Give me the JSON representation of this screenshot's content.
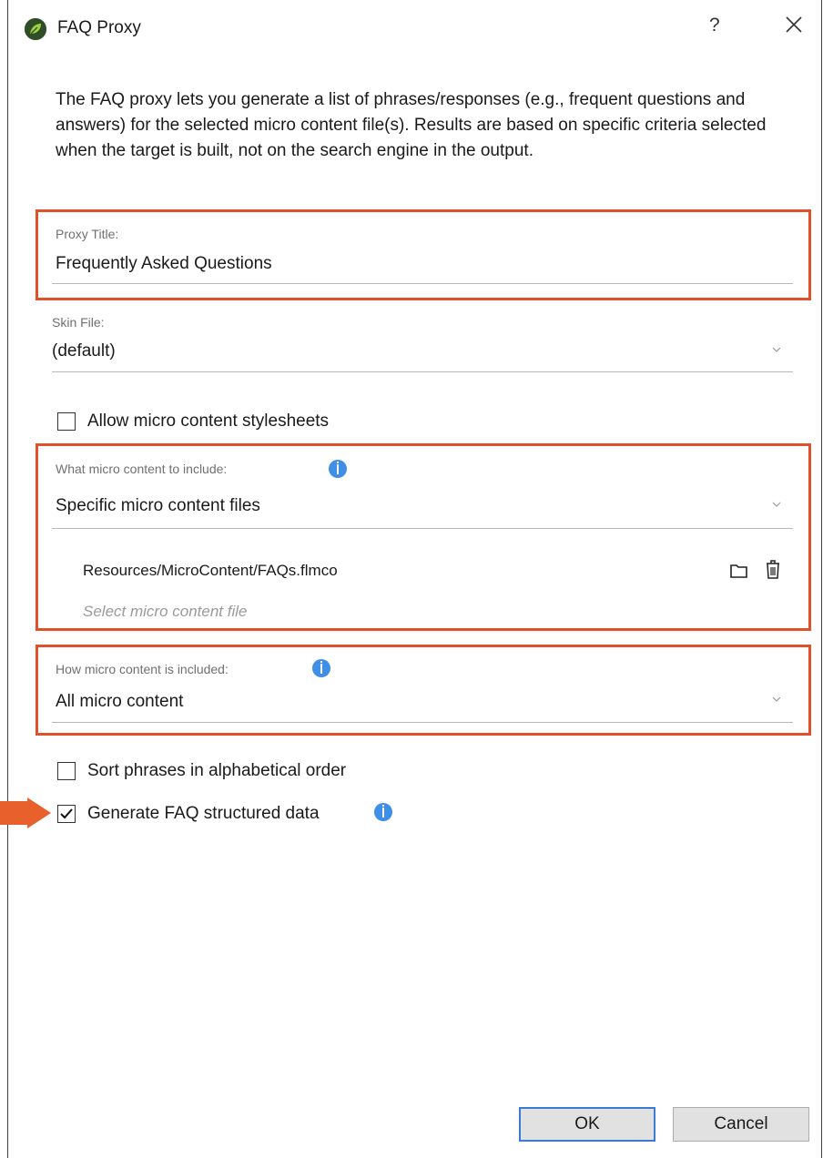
{
  "window": {
    "title": "FAQ Proxy",
    "help_label": "?",
    "close_icon": "close-icon"
  },
  "description": "The FAQ proxy lets you generate a list of phrases/responses (e.g., frequent questions and answers) for the selected micro content file(s). Results are based on specific criteria selected when the target is built, not on the search engine in the output.",
  "proxy_title": {
    "label": "Proxy Title:",
    "value": "Frequently Asked Questions"
  },
  "skin_file": {
    "label": "Skin File:",
    "value": "(default)"
  },
  "allow_stylesheets": {
    "label": "Allow micro content stylesheets",
    "checked": false
  },
  "what_include": {
    "label": "What micro content to include:",
    "value": "Specific micro content files",
    "files": [
      "Resources/MicroContent/FAQs.flmco"
    ],
    "placeholder": "Select micro content file"
  },
  "how_include": {
    "label": "How micro content is included:",
    "value": "All micro content"
  },
  "sort_phrases": {
    "label": "Sort phrases in alphabetical order",
    "checked": false
  },
  "generate_faq": {
    "label": "Generate FAQ structured data",
    "checked": true
  },
  "buttons": {
    "ok": "OK",
    "cancel": "Cancel"
  },
  "colors": {
    "highlight": "#e0502a",
    "info": "#3f8fe6",
    "primary_border": "#3a7bd5"
  }
}
